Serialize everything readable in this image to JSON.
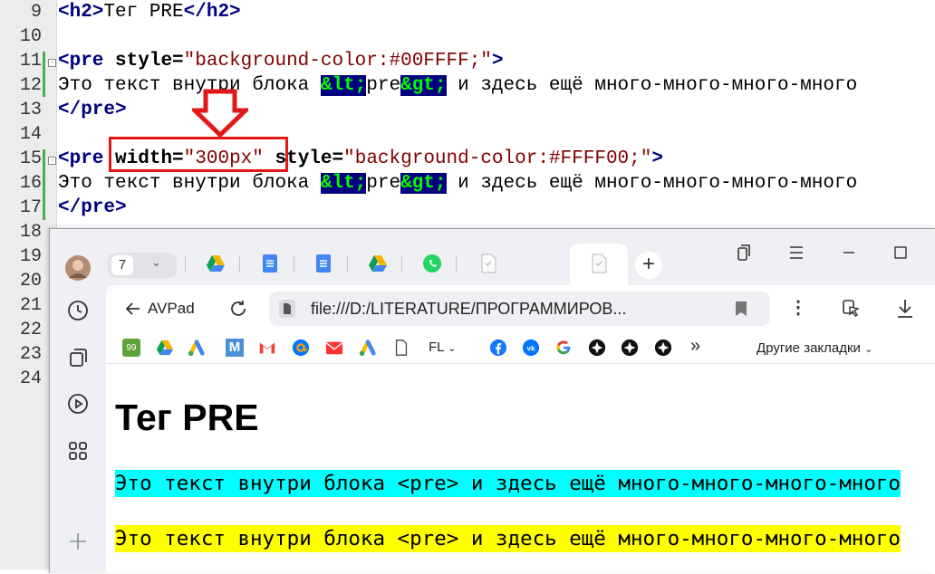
{
  "editor": {
    "line_numbers": [
      "9",
      "10",
      "11",
      "12",
      "13",
      "14",
      "15",
      "16",
      "17",
      "18",
      "19",
      "20",
      "21",
      "22",
      "23",
      "24"
    ],
    "lines": {
      "l9": {
        "open": "<h2>",
        "text": "Тег PRE",
        "close": "</h2>"
      },
      "l11": {
        "tag_open": "<pre",
        "attr": "style=",
        "value": "\"background-color:#00FFFF;\"",
        "tag_end": ">"
      },
      "l12": {
        "before": "Это текст внутри блока ",
        "ent1a": "&lt;",
        "mid": "pre",
        "ent1b": "&gt;",
        "after": " и здесь ещё много-много-много-много"
      },
      "l13": {
        "text": "</pre>"
      },
      "l15": {
        "tag_open": "<pre",
        "attr1": "width=",
        "value1": "\"300px\"",
        "attr2": "style=",
        "value2": "\"background-color:#FFFF00;\"",
        "tag_end": ">"
      },
      "l16": {
        "before": "Это текст внутри блока ",
        "ent1a": "&lt;",
        "mid": "pre",
        "ent1b": "&gt;",
        "after": " и здесь ещё много-много-много-много"
      },
      "l17": {
        "text": "</pre>"
      }
    },
    "highlight_color": "#e21818"
  },
  "browser": {
    "tab_count": "7",
    "back_label": "AVPad",
    "address": "file:///D:/LITERATURE/ПРОГРАММИРОВ...",
    "bookmarks": {
      "badge": "99",
      "folder_fl": "FL",
      "more": "»",
      "other": "Другие закладки"
    },
    "page": {
      "heading": "Тег PRE",
      "pre1": "Это текст внутри блока <pre> и здесь ещё много-много-много-много",
      "pre2": "Это текст внутри блока <pre> и здесь ещё много-много-много-много"
    },
    "colors": {
      "pre1_bg": "#00FFFF",
      "pre2_bg": "#FFFF00"
    }
  }
}
